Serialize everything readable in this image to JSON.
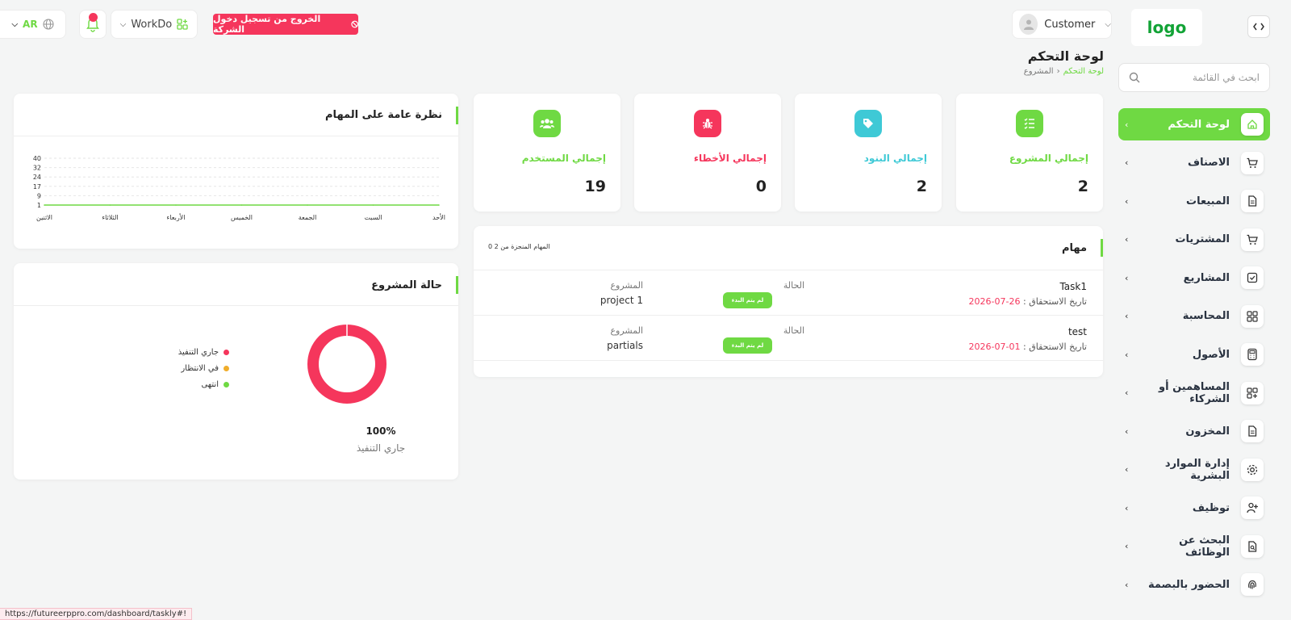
{
  "header": {
    "logo": "logo",
    "user_name": "Customer",
    "exit_label": "الخروج من تسجيل دخول الشركة",
    "workspace": "WorkDo",
    "language": "AR",
    "notification_count": "0"
  },
  "page": {
    "title": "لوحة التحكم",
    "breadcrumb": [
      "لوحة التحكم",
      "المشروع"
    ]
  },
  "sidebar": {
    "search_placeholder": "ابحث في القائمة",
    "items": [
      {
        "label": "لوحة التحكم",
        "icon": "home-icon",
        "active": true
      },
      {
        "label": "الاصناف",
        "icon": "cart-icon"
      },
      {
        "label": "المبيعات",
        "icon": "file-icon"
      },
      {
        "label": "المشتريات",
        "icon": "cart-icon"
      },
      {
        "label": "المشاريع",
        "icon": "check-square-icon"
      },
      {
        "label": "المحاسبة",
        "icon": "grid-icon"
      },
      {
        "label": "الأصول",
        "icon": "calculator-icon"
      },
      {
        "label": "المساهمين أو الشركاء",
        "icon": "grid-plus-icon"
      },
      {
        "label": "المخزون",
        "icon": "file-icon"
      },
      {
        "label": "إدارة الموارد البشرية",
        "icon": "settings-icon"
      },
      {
        "label": "توظيف",
        "icon": "user-plus-icon"
      },
      {
        "label": "البحث عن الوظائف",
        "icon": "file-search-icon"
      },
      {
        "label": "الحضور بالبصمة",
        "icon": "fingerprint-icon"
      }
    ]
  },
  "stats": [
    {
      "label": "إجمالي المشروع",
      "value": "2",
      "color": "#6fd943",
      "icon": "list-check-icon"
    },
    {
      "label": "إجمالي البنود",
      "value": "2",
      "color": "#3ec9d6",
      "icon": "tag-icon"
    },
    {
      "label": "إجمالي الأخطاء",
      "value": "0",
      "color": "#f5365c",
      "icon": "bug-icon"
    },
    {
      "label": "إجمالي المستخدم",
      "value": "19",
      "color": "#6fd943",
      "icon": "users-icon"
    }
  ],
  "tasks": {
    "title": "مهام",
    "subtitle": "0 المهام المنجزة من 2",
    "status_header": "الحالة",
    "project_header": "المشروع",
    "due_label": "تاريخ الاستحقاق :",
    "rows": [
      {
        "name": "Task1",
        "due": "26-07-2026",
        "status": "لم يتم البدء",
        "project": "project 1"
      },
      {
        "name": "test",
        "due": "01-07-2026",
        "status": "لم يتم البدء",
        "project": "partials"
      }
    ]
  },
  "overview": {
    "title": "نظرة عامة على المهام"
  },
  "project_status": {
    "title": "حالة المشروع",
    "percent": "100%",
    "percent_label": "جاري التنفيذ"
  },
  "chart_data": [
    {
      "type": "line",
      "categories": [
        "الأحد",
        "السبت",
        "الجمعة",
        "الخميس",
        "الأربعاء",
        "الثلاثاء",
        "الاثنين"
      ],
      "series": [
        {
          "values": [
            0,
            0,
            0,
            0,
            0,
            0,
            0
          ]
        }
      ],
      "yticks": [
        "40",
        "32",
        "24",
        "17",
        "9",
        "1"
      ],
      "ylim": [
        0,
        40
      ],
      "grid": true,
      "color": "#6fd943"
    },
    {
      "type": "pie",
      "labels": [
        "جاري التنفيذ",
        "في الانتظار",
        "انتهى"
      ],
      "values": [
        100,
        0,
        0
      ],
      "colors": [
        "#f5365c",
        "#f0ad2b",
        "#6fd943"
      ]
    }
  ],
  "status_bar": {
    "url": "https://futureerppro.com/dashboard/taskly#!"
  }
}
